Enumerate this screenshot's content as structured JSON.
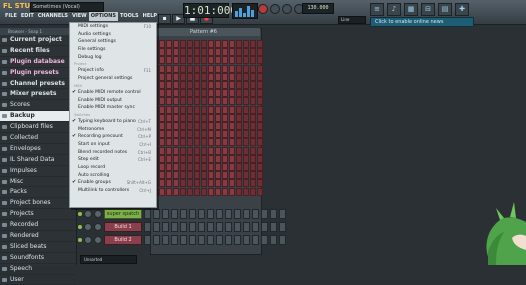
{
  "app": {
    "logo": "FL STUDIO",
    "project_title": "Sometimes (Vocal)"
  },
  "menubar": [
    "FILE",
    "EDIT",
    "CHANNELS",
    "VIEW",
    "OPTIONS",
    "TOOLS",
    "HELP"
  ],
  "transport": {
    "time": "1:01:000",
    "buttons": [
      "pat-song",
      "play",
      "stop",
      "record"
    ]
  },
  "tempo": "130.000",
  "pattern_select": "Line",
  "news": "Click to enable online news",
  "browser": {
    "header": "Browser - Snap 1",
    "items": [
      {
        "label": "Current project",
        "style": "b"
      },
      {
        "label": "Recent files",
        "style": "b"
      },
      {
        "label": "Plugin database",
        "style": "b pink"
      },
      {
        "label": "Plugin presets",
        "style": "b pink"
      },
      {
        "label": "Channel presets",
        "style": "b"
      },
      {
        "label": "Mixer presets",
        "style": "b"
      },
      {
        "label": "Scores",
        "style": ""
      },
      {
        "label": "Backup",
        "style": "sel b"
      },
      {
        "label": "Clipboard files",
        "style": ""
      },
      {
        "label": "Collected",
        "style": ""
      },
      {
        "label": "Envelopes",
        "style": ""
      },
      {
        "label": "IL Shared Data",
        "style": ""
      },
      {
        "label": "Impulses",
        "style": ""
      },
      {
        "label": "Misc",
        "style": ""
      },
      {
        "label": "Packs",
        "style": ""
      },
      {
        "label": "Project bones",
        "style": ""
      },
      {
        "label": "Projects",
        "style": ""
      },
      {
        "label": "Recorded",
        "style": ""
      },
      {
        "label": "Rendered",
        "style": ""
      },
      {
        "label": "Sliced beats",
        "style": ""
      },
      {
        "label": "Soundfonts",
        "style": ""
      },
      {
        "label": "Speech",
        "style": ""
      },
      {
        "label": "User",
        "style": ""
      }
    ]
  },
  "rack": {
    "title": "Pattern #6"
  },
  "channels": [
    {
      "name": "super spatch",
      "color": "green"
    },
    {
      "name": "Build 1",
      "color": "red"
    },
    {
      "name": "Build 2",
      "color": "red"
    }
  ],
  "bottom_select": "Unsorted",
  "options_menu": [
    {
      "type": "item",
      "label": "MIDI settings",
      "shortcut": "F10"
    },
    {
      "type": "item",
      "label": "Audio settings",
      "shortcut": ""
    },
    {
      "type": "item",
      "label": "General settings",
      "shortcut": ""
    },
    {
      "type": "item",
      "label": "File settings",
      "shortcut": ""
    },
    {
      "type": "item",
      "label": "Debug log",
      "shortcut": ""
    },
    {
      "type": "hdr",
      "label": "Project"
    },
    {
      "type": "item",
      "label": "Project info",
      "shortcut": "F11"
    },
    {
      "type": "item",
      "label": "Project general settings",
      "shortcut": ""
    },
    {
      "type": "hdr",
      "label": "MIDI"
    },
    {
      "type": "item",
      "label": "Enable MIDI remote control",
      "shortcut": "",
      "checked": true
    },
    {
      "type": "item",
      "label": "Enable MIDI output",
      "shortcut": ""
    },
    {
      "type": "item",
      "label": "Enable MIDI master sync",
      "shortcut": ""
    },
    {
      "type": "hdr",
      "label": "Switches"
    },
    {
      "type": "item",
      "label": "Typing keyboard to piano",
      "shortcut": "Ctrl+T",
      "checked": true
    },
    {
      "type": "item",
      "label": "Metronome",
      "shortcut": "Ctrl+M"
    },
    {
      "type": "item",
      "label": "Recording precount",
      "shortcut": "Ctrl+P",
      "checked": true
    },
    {
      "type": "item",
      "label": "Start on input",
      "shortcut": "Ctrl+I"
    },
    {
      "type": "item",
      "label": "Blend recorded notes",
      "shortcut": "Ctrl+B"
    },
    {
      "type": "item",
      "label": "Step edit",
      "shortcut": "Ctrl+E"
    },
    {
      "type": "item",
      "label": "Loop record",
      "shortcut": ""
    },
    {
      "type": "item",
      "label": "Auto scrolling",
      "shortcut": ""
    },
    {
      "type": "item",
      "label": "Enable groups",
      "shortcut": "Shift+Alt+G",
      "checked": true
    },
    {
      "type": "item",
      "label": "Multilink to controllers",
      "shortcut": "Ctrl+J"
    }
  ],
  "colors": {
    "accent": "#ffc14a",
    "step_red": "#8a3a40",
    "news_blue": "#1f5d74",
    "menu_bg": "#dfe4e6"
  }
}
